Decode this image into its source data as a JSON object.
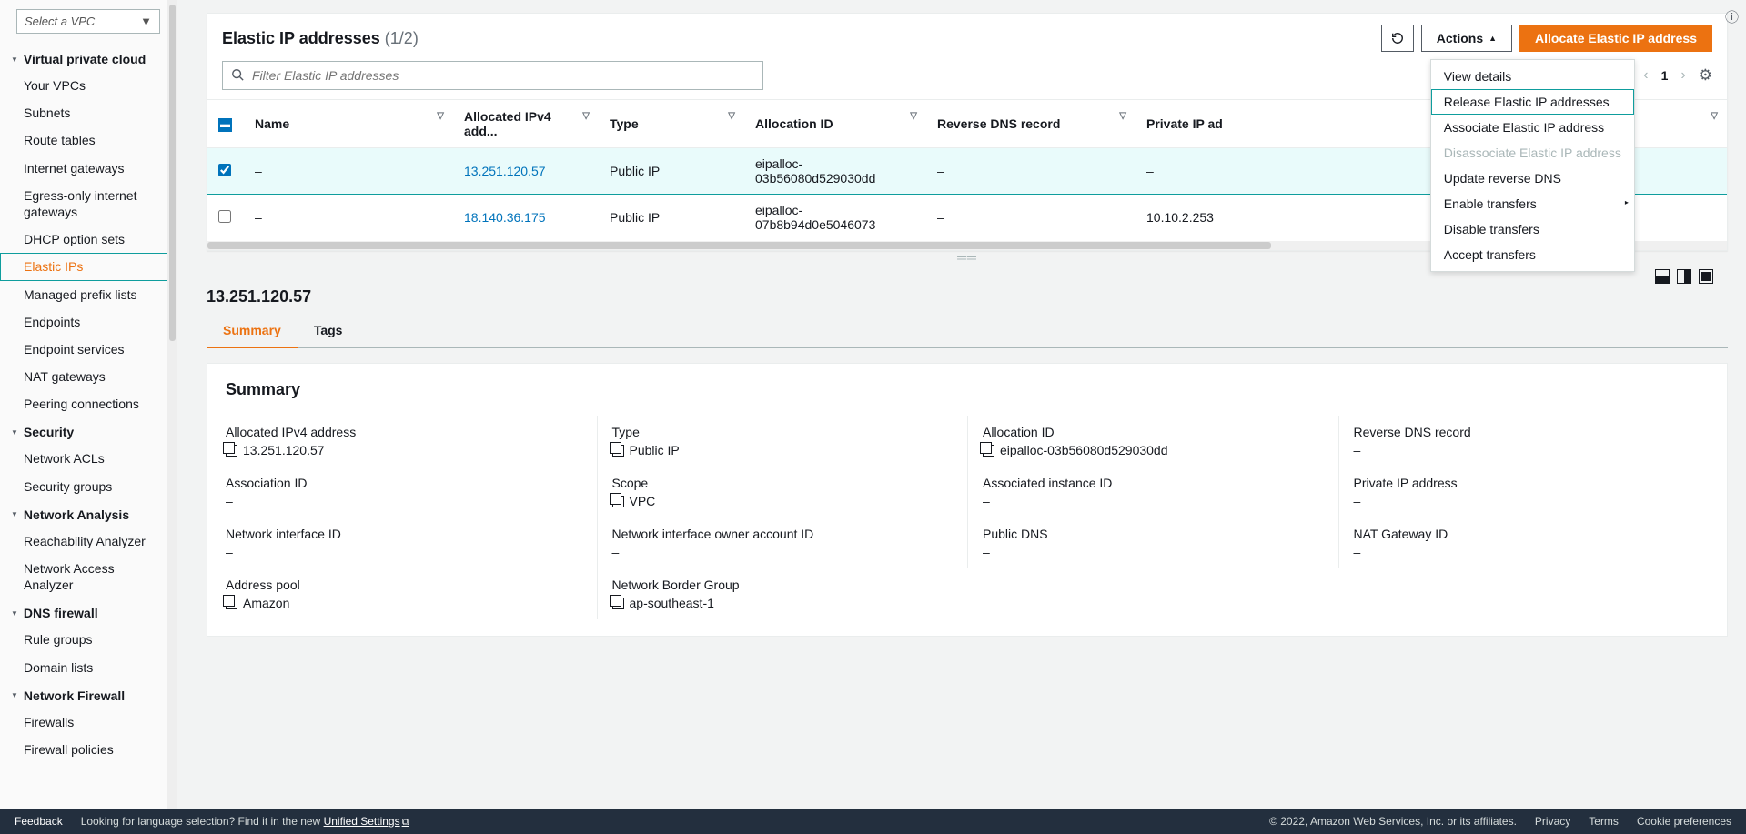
{
  "sidebar": {
    "vpcSelectorLabel": "Select a VPC",
    "sections": [
      {
        "title": "Virtual private cloud",
        "items": [
          "Your VPCs",
          "Subnets",
          "Route tables",
          "Internet gateways",
          "Egress-only internet gateways",
          "DHCP option sets",
          "Elastic IPs",
          "Managed prefix lists",
          "Endpoints",
          "Endpoint services",
          "NAT gateways",
          "Peering connections"
        ],
        "activeIndex": 6
      },
      {
        "title": "Security",
        "items": [
          "Network ACLs",
          "Security groups"
        ]
      },
      {
        "title": "Network Analysis",
        "items": [
          "Reachability Analyzer",
          "Network Access Analyzer"
        ]
      },
      {
        "title": "DNS firewall",
        "items": [
          "Rule groups",
          "Domain lists"
        ]
      },
      {
        "title": "Network Firewall",
        "items": [
          "Firewalls",
          "Firewall policies"
        ]
      }
    ]
  },
  "header": {
    "title": "Elastic IP addresses",
    "countLabel": "(1/2)",
    "actionsLabel": "Actions",
    "allocateLabel": "Allocate Elastic IP address",
    "searchPlaceholder": "Filter Elastic IP addresses",
    "page": "1"
  },
  "actionsMenu": [
    {
      "label": "View details",
      "disabled": false
    },
    {
      "label": "Release Elastic IP addresses",
      "disabled": false,
      "highlighted": true
    },
    {
      "label": "Associate Elastic IP address",
      "disabled": false
    },
    {
      "label": "Disassociate Elastic IP address",
      "disabled": true
    },
    {
      "label": "Update reverse DNS",
      "disabled": false
    },
    {
      "label": "Enable transfers",
      "disabled": false,
      "hasSubmenu": true
    },
    {
      "label": "Disable transfers",
      "disabled": false
    },
    {
      "label": "Accept transfers",
      "disabled": false
    }
  ],
  "table": {
    "columns": [
      "Name",
      "Allocated IPv4 add...",
      "Type",
      "Allocation ID",
      "Reverse DNS record",
      "Private IP ad"
    ],
    "rows": [
      {
        "selected": true,
        "name": "–",
        "ip": "13.251.120.57",
        "type": "Public IP",
        "alloc": "eipalloc-03b56080d529030dd",
        "reverseDns": "–",
        "private": "–"
      },
      {
        "selected": false,
        "name": "–",
        "ip": "18.140.36.175",
        "type": "Public IP",
        "alloc": "eipalloc-07b8b94d0e5046073",
        "reverseDns": "–",
        "private": "10.10.2.253"
      }
    ]
  },
  "details": {
    "title": "13.251.120.57",
    "tabs": [
      "Summary",
      "Tags"
    ],
    "activeTab": 0,
    "summaryHeading": "Summary",
    "fields": [
      {
        "label": "Allocated IPv4 address",
        "value": "13.251.120.57",
        "copy": true
      },
      {
        "label": "Type",
        "value": "Public IP",
        "copy": true
      },
      {
        "label": "Allocation ID",
        "value": "eipalloc-03b56080d529030dd",
        "copy": true
      },
      {
        "label": "Reverse DNS record",
        "value": "–",
        "copy": false
      },
      {
        "label": "Association ID",
        "value": "–",
        "copy": false
      },
      {
        "label": "Scope",
        "value": "VPC",
        "copy": true
      },
      {
        "label": "Associated instance ID",
        "value": "–",
        "copy": false
      },
      {
        "label": "Private IP address",
        "value": "–",
        "copy": false
      },
      {
        "label": "Network interface ID",
        "value": "–",
        "copy": false
      },
      {
        "label": "Network interface owner account ID",
        "value": "–",
        "copy": false
      },
      {
        "label": "Public DNS",
        "value": "–",
        "copy": false
      },
      {
        "label": "NAT Gateway ID",
        "value": "–",
        "copy": false
      },
      {
        "label": "Address pool",
        "value": "Amazon",
        "copy": true
      },
      {
        "label": "Network Border Group",
        "value": "ap-southeast-1",
        "copy": true
      }
    ]
  },
  "footer": {
    "feedback": "Feedback",
    "langPrompt": "Looking for language selection? Find it in the new",
    "unified": "Unified Settings",
    "copyright": "© 2022, Amazon Web Services, Inc. or its affiliates.",
    "privacy": "Privacy",
    "terms": "Terms",
    "cookies": "Cookie preferences"
  }
}
